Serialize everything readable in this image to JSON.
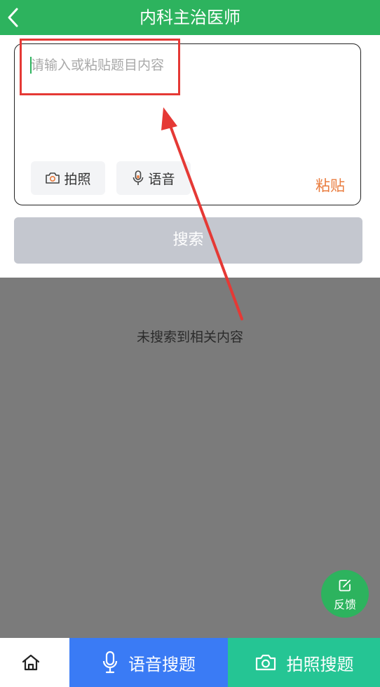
{
  "header": {
    "title": "内科主治医师",
    "back_icon": "chevron-left-icon"
  },
  "input": {
    "placeholder": "请输入或粘贴题目内容",
    "value": ""
  },
  "actions": {
    "photo_label": "拍照",
    "photo_icon": "camera-icon",
    "voice_label": "语音",
    "voice_icon": "microphone-icon",
    "paste_label": "粘贴"
  },
  "search": {
    "button_label": "搜索"
  },
  "results": {
    "empty_text": "未搜索到相关内容"
  },
  "feedback": {
    "label": "反馈",
    "icon": "edit-icon"
  },
  "bottom_bar": {
    "home_icon": "home-icon",
    "voice_search_label": "语音搜题",
    "voice_search_icon": "microphone-icon",
    "photo_search_label": "拍照搜题",
    "photo_search_icon": "camera-icon"
  },
  "colors": {
    "brand_green": "#2db35e",
    "paste_orange": "#e97b3d",
    "search_disabled": "#c4c7cf",
    "voice_blue": "#3a7bf5",
    "photo_teal": "#25c594",
    "overlay_gray": "#7b7b7b",
    "annotation_red": "#e53935"
  }
}
